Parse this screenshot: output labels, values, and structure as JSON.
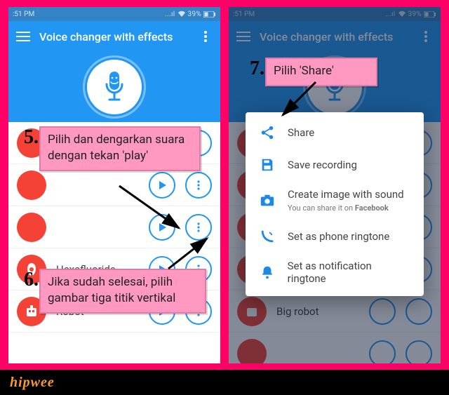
{
  "status": {
    "time": ":51 PM",
    "signal": "...ıl",
    "wifi": "⦿",
    "battery_pct": "39%",
    "battery_glyph": "▭"
  },
  "appbar": {
    "title": "Voice changer with effects"
  },
  "rows": [
    {
      "name": ""
    },
    {
      "name": ""
    },
    {
      "name": ""
    },
    {
      "name": "Hexafluoride"
    },
    {
      "name": "Robot"
    }
  ],
  "rows_right": [
    {
      "name": ""
    },
    {
      "name": ""
    },
    {
      "name": ""
    },
    {
      "name": ""
    },
    {
      "name": "Big robot"
    },
    {
      "name": ""
    }
  ],
  "sheet": {
    "share": "Share",
    "save": "Save recording",
    "image": "Create image with sound",
    "image_sub_a": "You can share it on ",
    "image_sub_b": "Facebook",
    "phone_rt": "Set as phone ringtone",
    "notif_rt": "Set as notification ringtone"
  },
  "callouts": {
    "c5_num": "5.",
    "c5_txt": "Pilih dan dengarkan suara dengan tekan 'play'",
    "c6_num": "6.",
    "c6_txt": "Jika sudah selesai, pilih gambar tiga titik vertikal",
    "c7_num": "7.",
    "c7_txt": "Pilih 'Share'"
  },
  "footer": {
    "brand": "hipwee"
  }
}
